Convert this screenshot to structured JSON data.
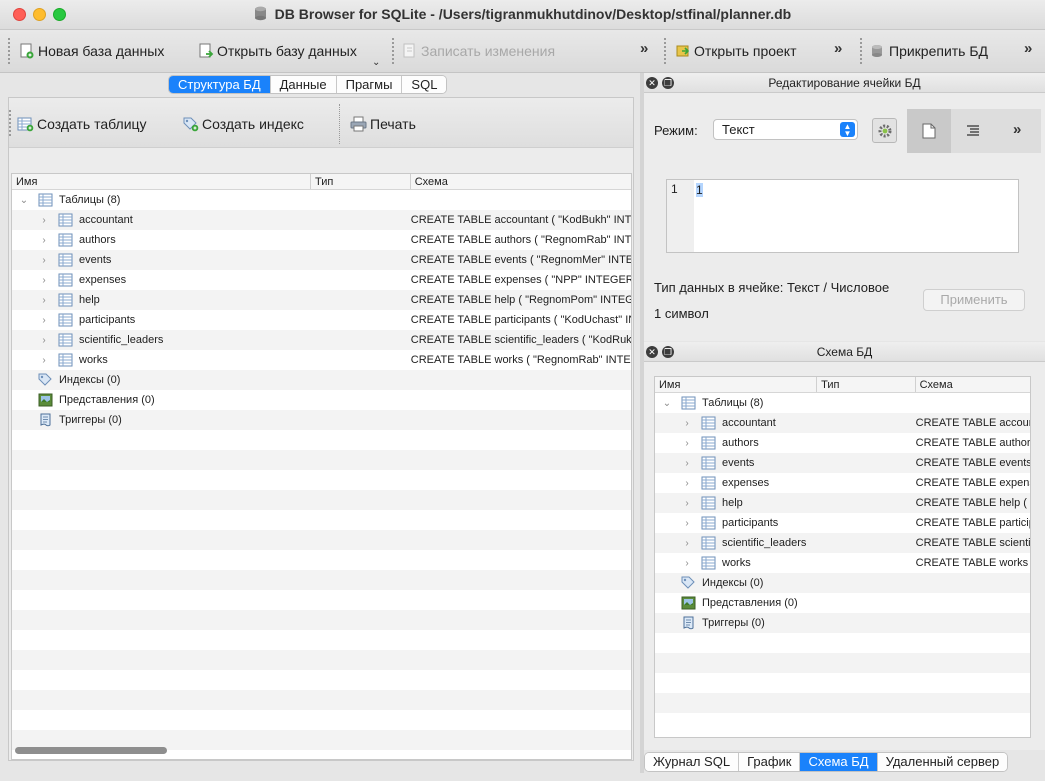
{
  "window": {
    "title": "DB Browser for SQLite - /Users/tigranmukhutdinov/Desktop/stfinal/planner.db"
  },
  "toolbar": {
    "new_db": "Новая база данных",
    "open_db": "Открыть базу данных",
    "write_changes": "Записать изменения",
    "open_project": "Открыть проект",
    "attach_db": "Прикрепить БД",
    "more": "»"
  },
  "left_tabs": [
    "Структура БД",
    "Данные",
    "Прагмы",
    "SQL"
  ],
  "structure_toolbar": {
    "create_table": "Создать таблицу",
    "create_index": "Создать индекс",
    "print": "Печать"
  },
  "columns": {
    "name": "Имя",
    "type": "Тип",
    "schema": "Схема"
  },
  "tree": {
    "tables_label": "Таблицы (8)",
    "indexes_label": "Индексы (0)",
    "views_label": "Представления (0)",
    "triggers_label": "Триггеры (0)",
    "tables": [
      {
        "name": "accountant",
        "schema": "CREATE TABLE accountant ( \"KodBukh\" INTEGER"
      },
      {
        "name": "authors",
        "schema": "CREATE TABLE authors ( \"RegnomRab\" INTEGER"
      },
      {
        "name": "events",
        "schema": "CREATE TABLE events ( \"RegnomMer\" INTEGER"
      },
      {
        "name": "expenses",
        "schema": "CREATE TABLE expenses ( \"NPP\" INTEGER NOT"
      },
      {
        "name": "help",
        "schema": "CREATE TABLE help ( \"RegnomPom\" INTEGER"
      },
      {
        "name": "participants",
        "schema": "CREATE TABLE participants ( \"KodUchast\" INTEGER"
      },
      {
        "name": "scientific_leaders",
        "schema": "CREATE TABLE scientific_leaders ( \"KodRuk\" INTEGER"
      },
      {
        "name": "works",
        "schema": "CREATE TABLE works ( \"RegnomRab\" INTEGER"
      }
    ]
  },
  "edit_cell": {
    "title": "Редактирование ячейки БД",
    "mode_label": "Режим:",
    "mode_value": "Текст",
    "line_number": "1",
    "cell_value": "1",
    "data_type": "Тип данных в ячейке: Текст / Числовое",
    "char_count": "1 символ",
    "apply": "Применить"
  },
  "schema_dock": {
    "title": "Схема БД",
    "tables": [
      {
        "name": "accountant",
        "schema": "CREATE TABLE accountant ("
      },
      {
        "name": "authors",
        "schema": "CREATE TABLE authors ("
      },
      {
        "name": "events",
        "schema": "CREATE TABLE events ("
      },
      {
        "name": "expenses",
        "schema": "CREATE TABLE expenses ("
      },
      {
        "name": "help",
        "schema": "CREATE TABLE help ( \""
      },
      {
        "name": "participants",
        "schema": "CREATE TABLE participants ("
      },
      {
        "name": "scientific_leaders",
        "schema": "CREATE TABLE scientific_leaders ("
      },
      {
        "name": "works",
        "schema": "CREATE TABLE works ("
      }
    ]
  },
  "bottom_tabs": [
    "Журнал SQL",
    "График",
    "Схема БД",
    "Удаленный сервер"
  ],
  "colors": {
    "accent": "#1a82fb",
    "selection": "#b4d5fe"
  }
}
